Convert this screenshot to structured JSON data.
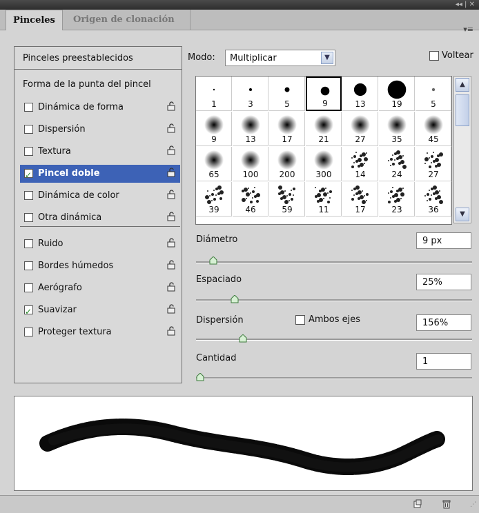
{
  "tabs": [
    {
      "label": "Pinceles"
    },
    {
      "label": "Origen de clonación"
    }
  ],
  "window_controls": "◂◂ | ✕",
  "panel_menu": "▾≡",
  "sidebar": {
    "presets": "Pinceles preestablecidos",
    "tip_shape": "Forma de la punta del pincel",
    "items": [
      {
        "label": "Dinámica de forma",
        "checked": false
      },
      {
        "label": "Dispersión",
        "checked": false
      },
      {
        "label": "Textura",
        "checked": false
      },
      {
        "label": "Pincel doble",
        "checked": true
      },
      {
        "label": "Dinámica de color",
        "checked": false
      },
      {
        "label": "Otra dinámica",
        "checked": false
      },
      {
        "label": "Ruido",
        "checked": false
      },
      {
        "label": "Bordes húmedos",
        "checked": false
      },
      {
        "label": "Aerógrafo",
        "checked": false
      },
      {
        "label": "Suavizar",
        "checked": true
      },
      {
        "label": "Proteger textura",
        "checked": false
      }
    ],
    "selected_index": 3
  },
  "mode": {
    "label": "Modo:",
    "value": "Multiplicar"
  },
  "flip": {
    "label": "Voltear",
    "checked": false
  },
  "brush_sizes": [
    "1",
    "3",
    "5",
    "9",
    "13",
    "19",
    "5",
    "9",
    "13",
    "17",
    "21",
    "27",
    "35",
    "45",
    "65",
    "100",
    "200",
    "300",
    "14",
    "24",
    "27",
    "39",
    "46",
    "59",
    "11",
    "17",
    "23",
    "36"
  ],
  "selected_brush": 3,
  "controls": {
    "diameter": {
      "label": "Diámetro",
      "value": "9 px"
    },
    "spacing": {
      "label": "Espaciado",
      "value": "25%"
    },
    "scatter": {
      "label": "Dispersión",
      "value": "156%",
      "both_axes": "Ambos ejes"
    },
    "count": {
      "label": "Cantidad",
      "value": "1"
    }
  },
  "slider_levels": {
    "diameter": 0.05,
    "spacing": 0.13,
    "scatter": 0.16,
    "count": 0.0
  },
  "colors": {
    "selection": "#3d62b6",
    "check": "#2a8a2a"
  }
}
